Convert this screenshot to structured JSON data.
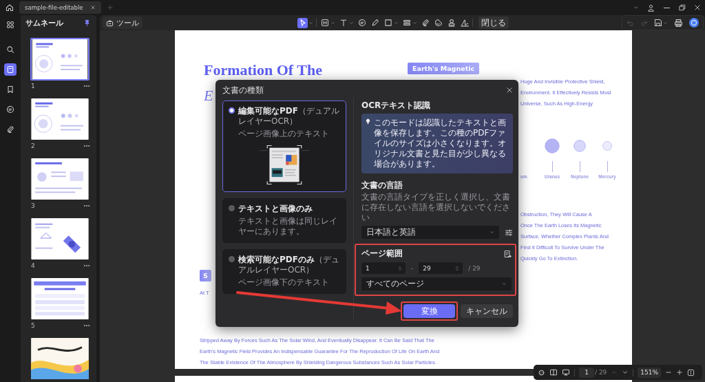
{
  "tabs": [
    {
      "label": "sample-file-editable",
      "selected": true
    }
  ],
  "rail": [
    {
      "kind": "grid",
      "selected": false
    },
    {
      "kind": "search",
      "selected": false
    },
    {
      "kind": "pages",
      "selected": true
    },
    {
      "kind": "bookmark",
      "selected": false
    },
    {
      "kind": "comment",
      "selected": false
    },
    {
      "kind": "attachment",
      "selected": false
    }
  ],
  "thumbnails": {
    "title": "サムネール",
    "pinned": true,
    "pages": [
      {
        "number": "1",
        "kind": "diagram",
        "selected": true
      },
      {
        "number": "2",
        "kind": "diagram",
        "selected": false
      },
      {
        "number": "3",
        "kind": "text",
        "selected": false
      },
      {
        "number": "4",
        "kind": "satellite",
        "selected": false
      },
      {
        "number": "5",
        "kind": "table",
        "selected": false
      },
      {
        "kind": "cover",
        "selected": false
      }
    ]
  },
  "toolbar": {
    "tools_button": "ツール",
    "tools": [
      {
        "kind": "select",
        "menu": true,
        "selected": true
      },
      {
        "kind": "heading",
        "menu": true,
        "selected": false
      },
      {
        "kind": "text",
        "menu": true,
        "selected": false
      },
      {
        "kind": "comment",
        "menu": false,
        "selected": false
      },
      {
        "kind": "pen",
        "menu": false,
        "selected": false
      },
      {
        "kind": "shape",
        "menu": true,
        "selected": false
      },
      {
        "kind": "field",
        "menu": true,
        "selected": false
      },
      {
        "kind": "attachment",
        "menu": false,
        "selected": false
      },
      {
        "kind": "sticker",
        "menu": false,
        "selected": false
      },
      {
        "kind": "stamp",
        "menu": false,
        "selected": false
      },
      {
        "kind": "signature",
        "menu": false,
        "selected": false
      }
    ],
    "close_button": "閉じる",
    "undo_disabled": true,
    "redo_disabled": true
  },
  "document": {
    "title": "Formation Of The",
    "subtitle": "E",
    "badge": "Earth's Magnetic",
    "upper_lines": [
      "Huge And Invisible Protective Shield,",
      "Environment. It Effectively Resists Most",
      "Universe, Such As High-Energy"
    ],
    "planets": [
      {
        "label": "um"
      },
      {
        "label": "Uranus",
        "color": "#b4b4f5"
      },
      {
        "label": "Neptune",
        "color": "#d8d8fa"
      },
      {
        "label": "Mercury",
        "color": "#ececfc"
      }
    ],
    "lower_lines": [
      "Obstruction, They Will Cause A",
      "Once The Earth Loses Its Magnetic",
      "Surface, Whether Complex Plants And",
      "Find It Difficult To Survive Under The",
      "Quickly Go To Extinction."
    ],
    "section_badge": "S",
    "section_lines": [
      "At T",
      "Stripped Away By Forces Such As The Solar Wind, And Eventually Disappear. It Can Be Said That The",
      "Earth's Magnetic Field Provides An Indispensable Guarantee For The Reproduction Of Life On Earth And",
      "The Stable Existence Of The Atmosphere By Shielding Dangerous Substances Such As Solar Particles."
    ]
  },
  "dialog": {
    "title": "文書の種類",
    "options": [
      {
        "kind": "illustrated",
        "title": "編集可能なPDF",
        "note": "（デュアルレイヤーOCR）",
        "description": "ページ画像上のテキスト",
        "selected": true
      },
      {
        "kind": "plain",
        "title": "テキストと画像のみ",
        "description": "テキストと画像は同じレイヤーにあります。",
        "selected": false
      },
      {
        "kind": "plain",
        "title": "検索可能なPDFのみ",
        "note": "（デュアルレイヤーOCR）",
        "description": "ページ画像下のテキスト",
        "selected": false
      }
    ],
    "ocr_heading": "OCRテキスト認識",
    "info": "このモードは認識したテキストと画像を保存します。この種のPDFファイルのサイズは小さくなります。オリジナル文書と見た目が少し異なる場合があります。",
    "language_heading": "文書の言語",
    "language_hint": "文書の言語タイプを正しく選択し、文書に存在しない言語を選択しないでください",
    "language": "日本語と英語",
    "range_heading": "ページ範囲",
    "range_from": "1",
    "range_separator": "-",
    "range_to": "29",
    "range_total": "/ 29",
    "range_preset": "すべてのページ",
    "convert_button": "変換",
    "cancel_button": "キャンセル"
  },
  "bottom_bar": {
    "page": "1",
    "total": "/ 29",
    "prev_disabled": true,
    "zoom": "151%"
  }
}
